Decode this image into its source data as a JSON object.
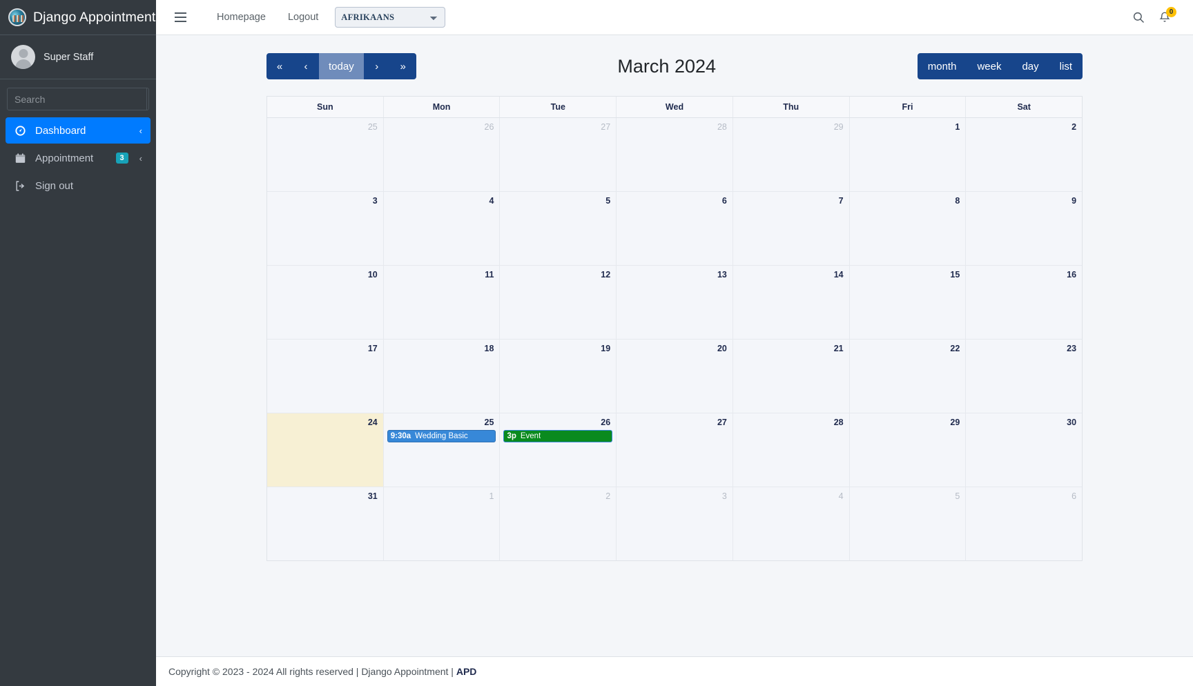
{
  "sidebar": {
    "brand": "Django Appointment",
    "brand_logo_icon": "django-globe-logo-icon",
    "user": {
      "name": "Super Staff",
      "avatar_icon": "avatar-icon"
    },
    "search": {
      "placeholder": "Search",
      "value": "",
      "button_icon": "search-icon"
    },
    "items": [
      {
        "label": "Dashboard",
        "icon": "speedometer-icon",
        "active": true,
        "badge": null,
        "chevron": "‹"
      },
      {
        "label": "Appointment",
        "icon": "calendar-icon",
        "active": false,
        "badge": "3",
        "chevron": "‹"
      },
      {
        "label": "Sign out",
        "icon": "sign-out-icon",
        "active": false,
        "badge": null,
        "chevron": ""
      }
    ]
  },
  "topbar": {
    "menu_icon": "hamburger-menu-icon",
    "links": [
      "Homepage",
      "Logout"
    ],
    "language": {
      "selected": "AFRIKAANS",
      "options": [
        "AFRIKAANS"
      ]
    },
    "search_icon": "search-icon",
    "notifications": {
      "icon": "bell-icon",
      "count": "0"
    }
  },
  "calendar": {
    "title": "March 2024",
    "nav_buttons": [
      {
        "label": "«",
        "name": "prev-year-button",
        "disabled": false
      },
      {
        "label": "‹",
        "name": "prev-month-button",
        "disabled": false
      },
      {
        "label": "today",
        "name": "today-button",
        "disabled": true
      },
      {
        "label": "›",
        "name": "next-month-button",
        "disabled": false
      },
      {
        "label": "»",
        "name": "next-year-button",
        "disabled": false
      }
    ],
    "view_buttons": [
      {
        "label": "month",
        "active": true
      },
      {
        "label": "week",
        "active": false
      },
      {
        "label": "day",
        "active": false
      },
      {
        "label": "list",
        "active": false
      }
    ],
    "day_headers": [
      "Sun",
      "Mon",
      "Tue",
      "Wed",
      "Thu",
      "Fri",
      "Sat"
    ],
    "weeks": [
      [
        {
          "num": "25",
          "other": true,
          "today": false,
          "events": []
        },
        {
          "num": "26",
          "other": true,
          "today": false,
          "events": []
        },
        {
          "num": "27",
          "other": true,
          "today": false,
          "events": []
        },
        {
          "num": "28",
          "other": true,
          "today": false,
          "events": []
        },
        {
          "num": "29",
          "other": true,
          "today": false,
          "events": []
        },
        {
          "num": "1",
          "other": false,
          "today": false,
          "events": []
        },
        {
          "num": "2",
          "other": false,
          "today": false,
          "events": []
        }
      ],
      [
        {
          "num": "3",
          "other": false,
          "today": false,
          "events": []
        },
        {
          "num": "4",
          "other": false,
          "today": false,
          "events": []
        },
        {
          "num": "5",
          "other": false,
          "today": false,
          "events": []
        },
        {
          "num": "6",
          "other": false,
          "today": false,
          "events": []
        },
        {
          "num": "7",
          "other": false,
          "today": false,
          "events": []
        },
        {
          "num": "8",
          "other": false,
          "today": false,
          "events": []
        },
        {
          "num": "9",
          "other": false,
          "today": false,
          "events": []
        }
      ],
      [
        {
          "num": "10",
          "other": false,
          "today": false,
          "events": []
        },
        {
          "num": "11",
          "other": false,
          "today": false,
          "events": []
        },
        {
          "num": "12",
          "other": false,
          "today": false,
          "events": []
        },
        {
          "num": "13",
          "other": false,
          "today": false,
          "events": []
        },
        {
          "num": "14",
          "other": false,
          "today": false,
          "events": []
        },
        {
          "num": "15",
          "other": false,
          "today": false,
          "events": []
        },
        {
          "num": "16",
          "other": false,
          "today": false,
          "events": []
        }
      ],
      [
        {
          "num": "17",
          "other": false,
          "today": false,
          "events": []
        },
        {
          "num": "18",
          "other": false,
          "today": false,
          "events": []
        },
        {
          "num": "19",
          "other": false,
          "today": false,
          "events": []
        },
        {
          "num": "20",
          "other": false,
          "today": false,
          "events": []
        },
        {
          "num": "21",
          "other": false,
          "today": false,
          "events": []
        },
        {
          "num": "22",
          "other": false,
          "today": false,
          "events": []
        },
        {
          "num": "23",
          "other": false,
          "today": false,
          "events": []
        }
      ],
      [
        {
          "num": "24",
          "other": false,
          "today": true,
          "events": []
        },
        {
          "num": "25",
          "other": false,
          "today": false,
          "events": [
            {
              "time": "9:30a",
              "title": "Wedding Basic",
              "color": "#3788d8",
              "border": "#2c6fb3"
            }
          ]
        },
        {
          "num": "26",
          "other": false,
          "today": false,
          "events": [
            {
              "time": "3p",
              "title": "Event",
              "color": "#0a8a1e",
              "border": "#3788d8"
            }
          ]
        },
        {
          "num": "27",
          "other": false,
          "today": false,
          "events": []
        },
        {
          "num": "28",
          "other": false,
          "today": false,
          "events": []
        },
        {
          "num": "29",
          "other": false,
          "today": false,
          "events": []
        },
        {
          "num": "30",
          "other": false,
          "today": false,
          "events": []
        }
      ],
      [
        {
          "num": "31",
          "other": false,
          "today": false,
          "events": []
        },
        {
          "num": "1",
          "other": true,
          "today": false,
          "events": []
        },
        {
          "num": "2",
          "other": true,
          "today": false,
          "events": []
        },
        {
          "num": "3",
          "other": true,
          "today": false,
          "events": []
        },
        {
          "num": "4",
          "other": true,
          "today": false,
          "events": []
        },
        {
          "num": "5",
          "other": true,
          "today": false,
          "events": []
        },
        {
          "num": "6",
          "other": true,
          "today": false,
          "events": []
        }
      ]
    ]
  },
  "footer": {
    "text": "Copyright © 2023 - 2024 All rights reserved | Django Appointment | ",
    "bold": "APD"
  }
}
